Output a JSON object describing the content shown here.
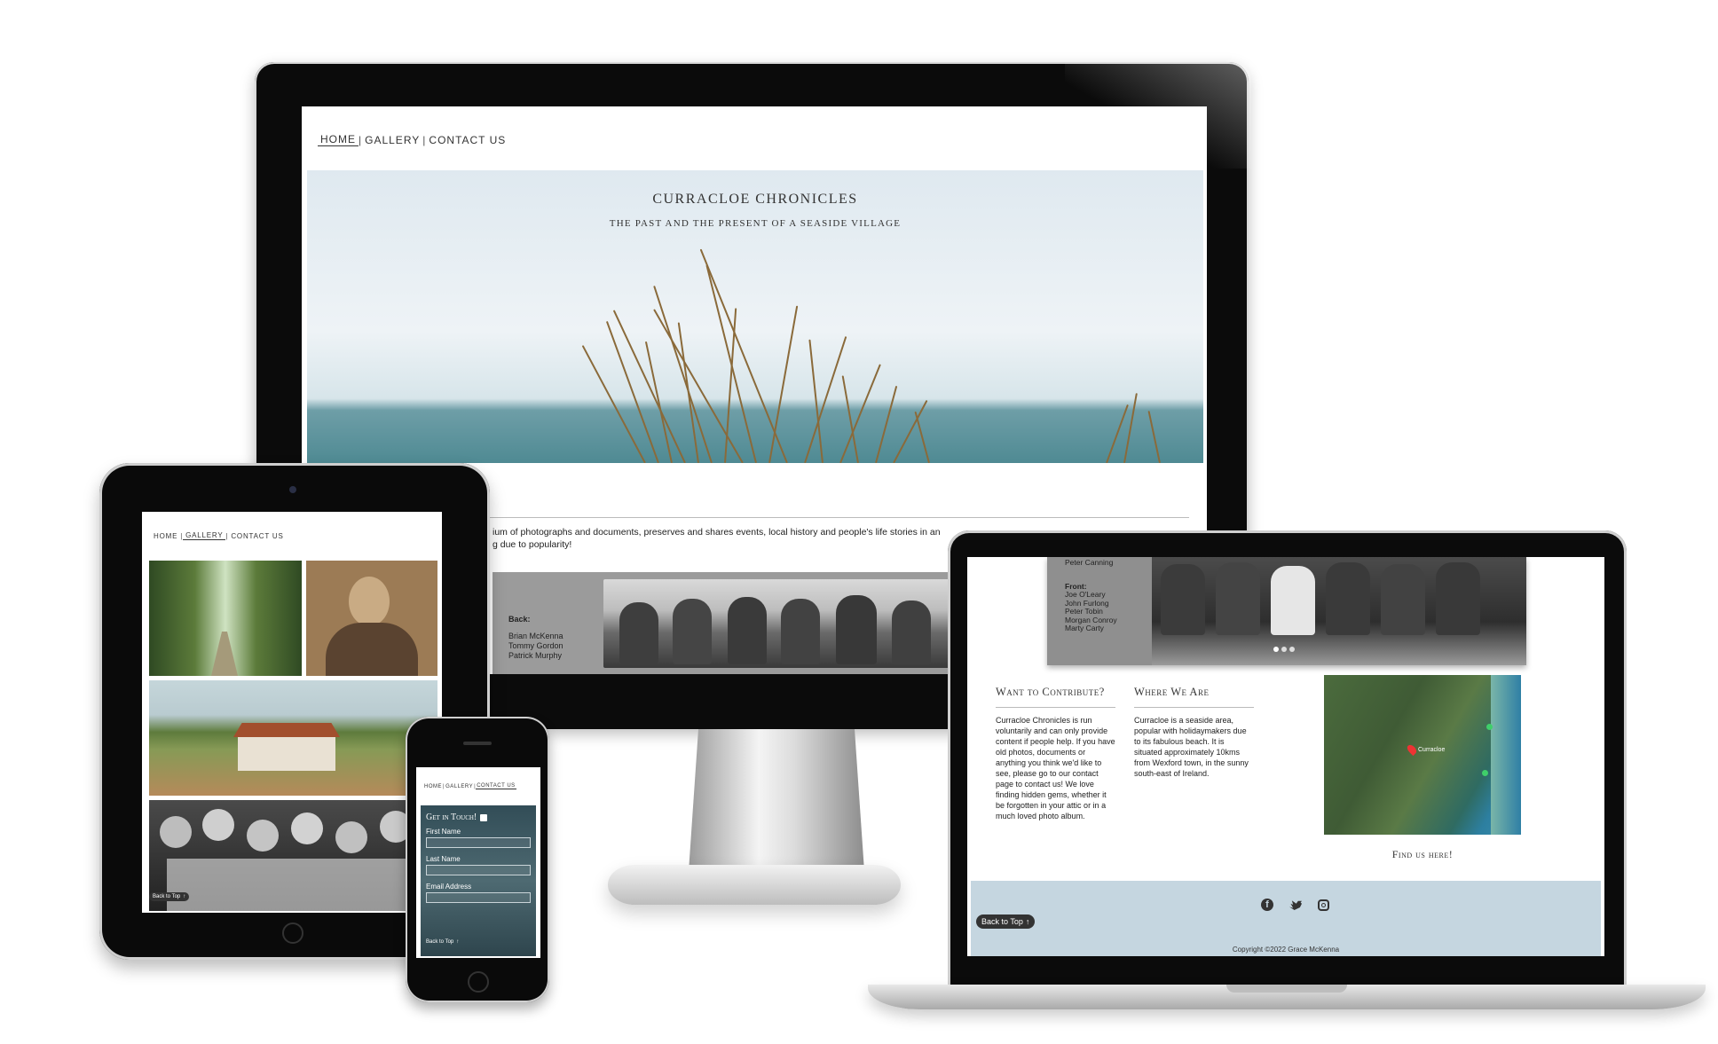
{
  "nav": {
    "items": [
      "HOME",
      "GALLERY",
      "CONTACT US"
    ],
    "separator": "|"
  },
  "desktop": {
    "active_nav": "HOME",
    "site_title": "CURRACLOE CHRONICLES",
    "site_subtitle": "THE PAST AND THE PRESENT OF A SEASIDE VILLAGE",
    "intro_line1": "ium of photographs and documents, preserves and shares events, local history and people's life stories in an",
    "intro_line2": "g due to popularity!",
    "strip_caption": {
      "back_heading": "Back:",
      "back_names": [
        "Brian McKenna",
        "Tommy Gordon",
        "Patrick Murphy"
      ]
    }
  },
  "tablet": {
    "active_nav": "GALLERY",
    "back_to_top": "Back to Top"
  },
  "phone": {
    "active_nav": "CONTACT US",
    "form_title": "Get in Touch!",
    "fields": [
      {
        "label": "First Name"
      },
      {
        "label": "Last Name"
      },
      {
        "label": "Email Address"
      }
    ],
    "back_to_top": "Back to Top"
  },
  "laptop": {
    "photo_caption": {
      "top_name": "Peter Canning",
      "front_heading": "Front:",
      "front_names": [
        "Joe O'Leary",
        "John Furlong",
        "Peter Tobin",
        "Morgan Conroy",
        "Marty Carty"
      ]
    },
    "contribute": {
      "heading": "Want to Contribute?",
      "body": "Curracloe Chronicles is run voluntarily and can only provide content if people help. If you have old photos, documents or anything you think we'd like to see, please go to our contact page to contact us! We love finding hidden gems, whether it be forgotten in your attic or in a much loved photo album."
    },
    "where": {
      "heading": "Where We Are",
      "body": "Curracloe is a seaside area, popular with holidaymakers due to its fabulous beach. It is situated approximately 10kms from Wexford town, in the sunny south-east of Ireland."
    },
    "map": {
      "label_curracloe": "Curracloe",
      "find_us": "Find us here!"
    },
    "social_icons": [
      "facebook-icon",
      "twitter-icon",
      "instagram-icon"
    ],
    "back_to_top": "Back to Top",
    "copyright": "Copyright ©2022 Grace McKenna"
  },
  "colors": {
    "footer_bg": "#c5d6e0",
    "device_frame": "#0b0b0b",
    "form_bg": "#3b5660"
  }
}
